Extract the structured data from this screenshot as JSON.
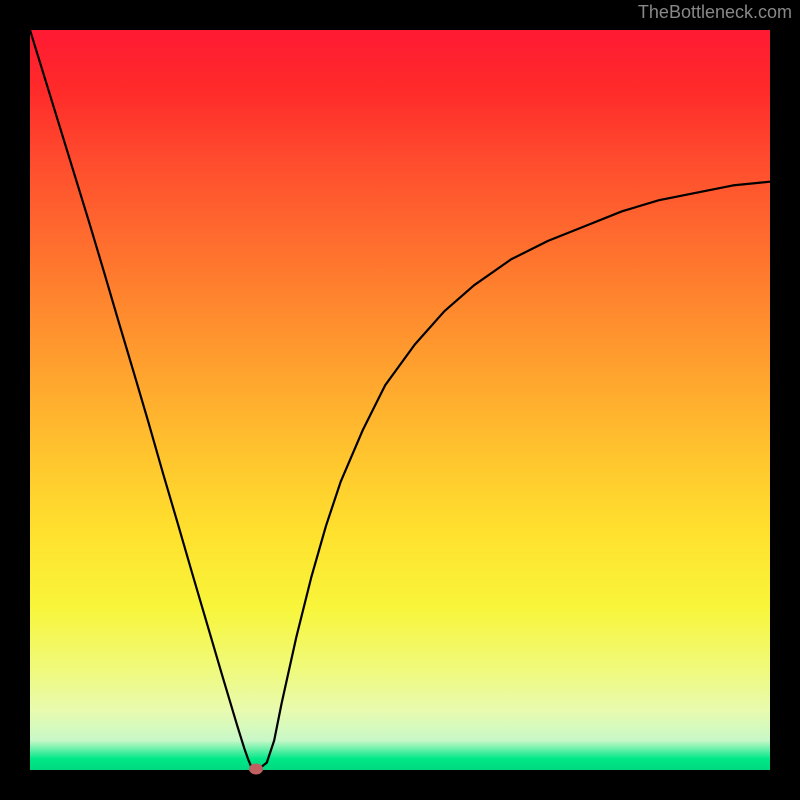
{
  "watermark": "TheBottleneck.com",
  "chart_data": {
    "type": "line",
    "title": "",
    "xlabel": "",
    "ylabel": "",
    "x": [
      0.0,
      0.02,
      0.04,
      0.06,
      0.08,
      0.1,
      0.12,
      0.14,
      0.16,
      0.18,
      0.2,
      0.22,
      0.24,
      0.26,
      0.28,
      0.29,
      0.295,
      0.3,
      0.305,
      0.31,
      0.32,
      0.33,
      0.34,
      0.36,
      0.38,
      0.4,
      0.42,
      0.45,
      0.48,
      0.52,
      0.56,
      0.6,
      0.65,
      0.7,
      0.75,
      0.8,
      0.85,
      0.9,
      0.95,
      1.0
    ],
    "y": [
      1.0,
      0.935,
      0.87,
      0.805,
      0.74,
      0.673,
      0.605,
      0.538,
      0.47,
      0.4,
      0.332,
      0.263,
      0.195,
      0.127,
      0.06,
      0.028,
      0.014,
      0.002,
      0.002,
      0.002,
      0.01,
      0.04,
      0.09,
      0.18,
      0.26,
      0.33,
      0.39,
      0.46,
      0.52,
      0.575,
      0.62,
      0.655,
      0.69,
      0.715,
      0.735,
      0.755,
      0.77,
      0.78,
      0.79,
      0.795
    ],
    "xlim": [
      0,
      1
    ],
    "ylim": [
      0,
      1
    ],
    "marker": {
      "x": 0.305,
      "y": 0.002
    },
    "gradient_colors": {
      "top": "#ff1a33",
      "mid_upper": "#ff8a2e",
      "mid": "#ffe12e",
      "mid_lower": "#f0fa78",
      "bottom": "#00d880"
    }
  }
}
